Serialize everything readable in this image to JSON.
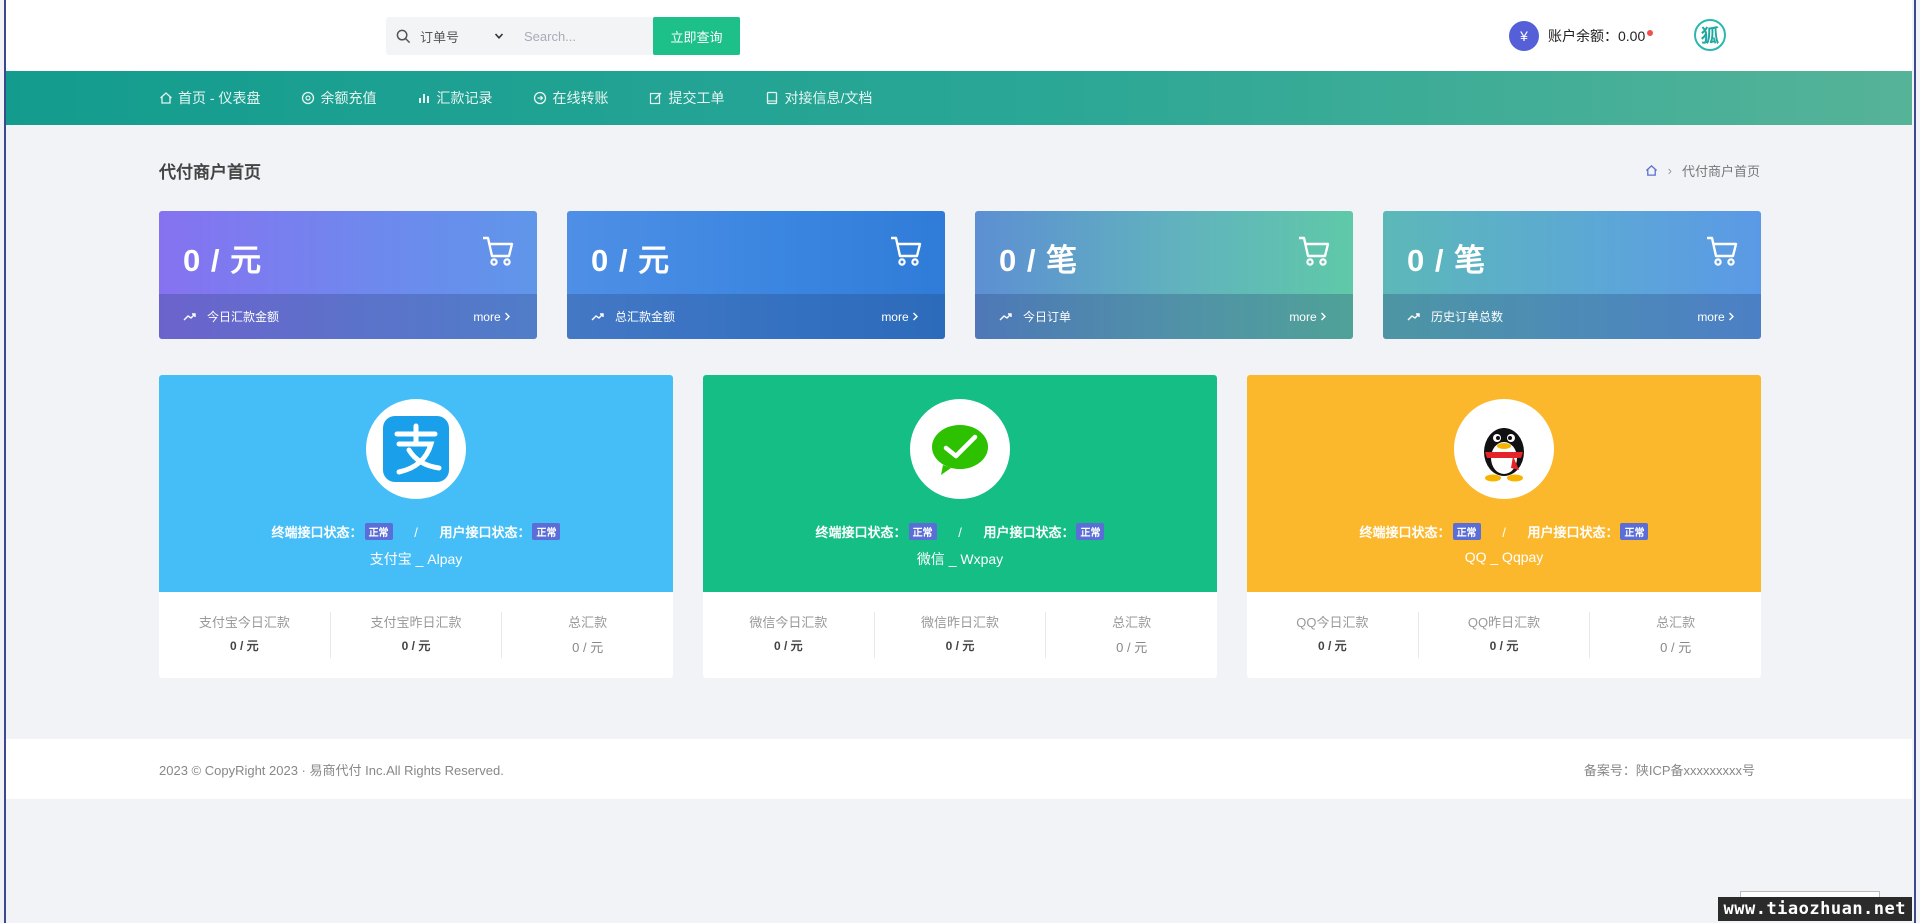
{
  "header": {
    "search": {
      "select_value": "订单号",
      "placeholder": "Search...",
      "button_label": "立即查询"
    },
    "balance": {
      "label": "账户余额：",
      "value": "0.00",
      "icon": "yen-icon"
    },
    "avatar": {
      "glyph": "狐",
      "icon": "avatar"
    }
  },
  "nav": {
    "items": [
      {
        "label": "首页 - 仪表盘",
        "icon": "home-icon"
      },
      {
        "label": "余额充值",
        "icon": "coin-icon"
      },
      {
        "label": "汇款记录",
        "icon": "bar-chart-icon"
      },
      {
        "label": "在线转账",
        "icon": "transfer-icon"
      },
      {
        "label": "提交工单",
        "icon": "edit-icon"
      },
      {
        "label": "对接信息/文档",
        "icon": "book-icon"
      }
    ]
  },
  "page": {
    "title": "代付商户首页",
    "breadcrumb": {
      "current": "代付商户首页"
    }
  },
  "stats": [
    {
      "value": "0 / 元",
      "label": "今日汇款金额",
      "more": "more"
    },
    {
      "value": "0 / 元",
      "label": "总汇款金额",
      "more": "more"
    },
    {
      "value": "0 / 笔",
      "label": "今日订单",
      "more": "more"
    },
    {
      "value": "0 / 笔",
      "label": "历史订单总数",
      "more": "more"
    }
  ],
  "pay_cards": [
    {
      "name": "支付宝 _ Alpay",
      "terminal_status_label": "终端接口状态：",
      "terminal_status": "正常",
      "user_status_label": "用户接口状态：",
      "user_status": "正常",
      "color": "#45bef8",
      "icon": "alipay-icon",
      "cols": [
        {
          "head": "支付宝今日汇款",
          "value": "0 / 元"
        },
        {
          "head": "支付宝昨日汇款",
          "value": "0 / 元"
        },
        {
          "head": "总汇款",
          "value": "0 / 元"
        }
      ]
    },
    {
      "name": "微信 _ Wxpay",
      "terminal_status_label": "终端接口状态：",
      "terminal_status": "正常",
      "user_status_label": "用户接口状态：",
      "user_status": "正常",
      "color": "#14be85",
      "icon": "wechat-icon",
      "cols": [
        {
          "head": "微信今日汇款",
          "value": "0 / 元"
        },
        {
          "head": "微信昨日汇款",
          "value": "0 / 元"
        },
        {
          "head": "总汇款",
          "value": "0 / 元"
        }
      ]
    },
    {
      "name": "QQ _ Qqpay",
      "terminal_status_label": "终端接口状态：",
      "terminal_status": "正常",
      "user_status_label": "用户接口状态：",
      "user_status": "正常",
      "color": "#fcb82d",
      "icon": "qq-icon",
      "cols": [
        {
          "head": "QQ今日汇款",
          "value": "0 / 元"
        },
        {
          "head": "QQ昨日汇款",
          "value": "0 / 元"
        },
        {
          "head": "总汇款",
          "value": "0 / 元"
        }
      ]
    }
  ],
  "footer": {
    "copyright": "2023 © CopyRight 2023 · 易商代付 Inc.All Rights Reserved.",
    "beian": "备案号：陕ICP备xxxxxxxxx号"
  },
  "watermark": "www.tiaozhuan.net"
}
